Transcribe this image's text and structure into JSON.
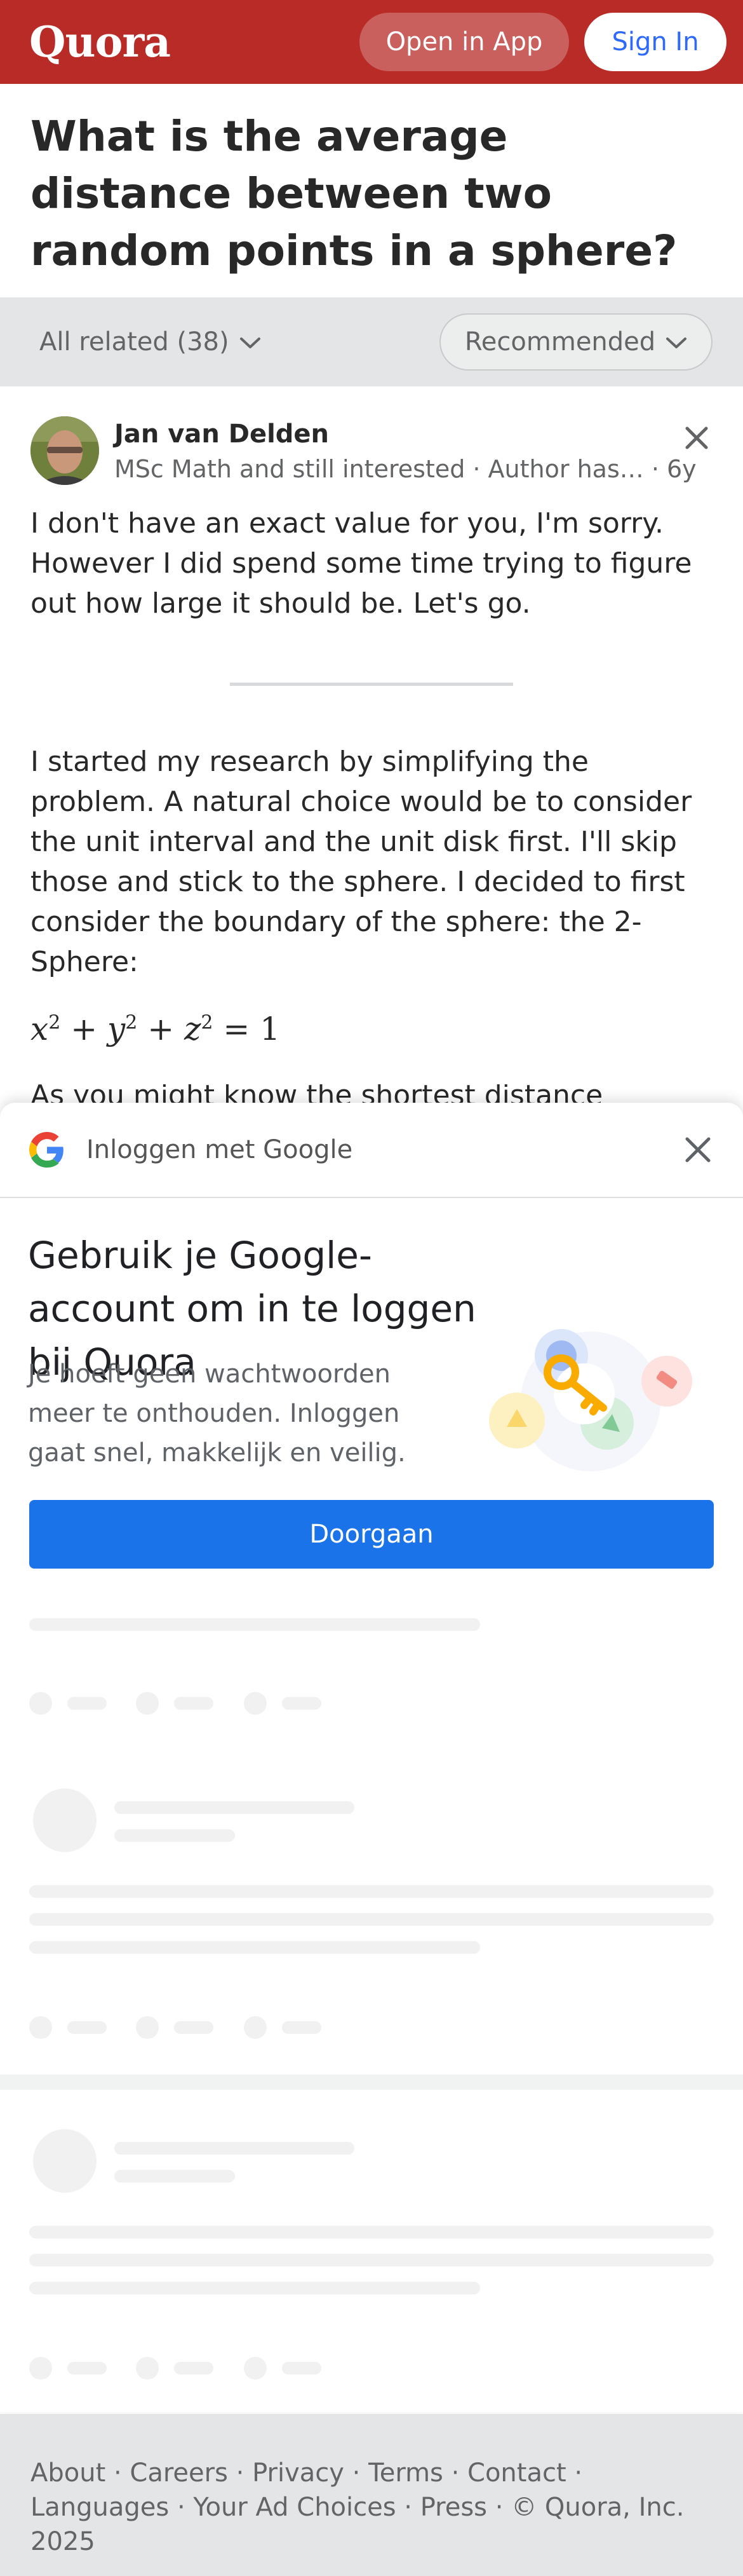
{
  "header": {
    "logo": "Quora",
    "open_in_app": "Open in App",
    "sign_in": "Sign In"
  },
  "question": {
    "title": "What is the average distance between two random points in a sphere?"
  },
  "filters": {
    "all_related": "All related (38)",
    "sort": "Recommended"
  },
  "answer": {
    "author_name": "Jan van Delden",
    "author_credential": "MSc Math and still interested · Author has…",
    "age": "· 6y",
    "para1": "I don't have an exact value for you, I'm sorry. However I did spend some time trying to figure out how large it should be. Let's go.",
    "para2": "I started my research by simplifying the problem. A natural choice would be to consider the unit interval and the unit disk first. I'll skip those and stick to the sphere. I decided to first consider the boundary of the sphere: the 2-Sphere:",
    "equation": {
      "x": "x",
      "y": "y",
      "z": "z",
      "exp": "2",
      "plus": "+",
      "rhs": "= 1"
    },
    "para3_partial": "As you might know the shortest distance"
  },
  "google_signin": {
    "title": "Inloggen met Google",
    "heading": "Gebruik je Google-account om in te loggen bij Quora",
    "subtext": "Je hoeft geen wachtwoorden meer te onthouden. Inloggen gaat snel, makkelijk en veilig.",
    "continue_button": "Doorgaan",
    "colors": {
      "button": "#1a73e8",
      "blue": "#4285f4",
      "red": "#ea4335",
      "yellow": "#fbbc05",
      "green": "#34a853"
    }
  },
  "footer": {
    "links": [
      "About",
      "Careers",
      "Privacy",
      "Terms",
      "Contact",
      "Languages",
      "Your Ad Choices",
      "Press"
    ],
    "copyright": "© Quora, Inc. 2025"
  },
  "colors": {
    "brand": "#b92b27",
    "link_blue": "#2e69ff"
  }
}
